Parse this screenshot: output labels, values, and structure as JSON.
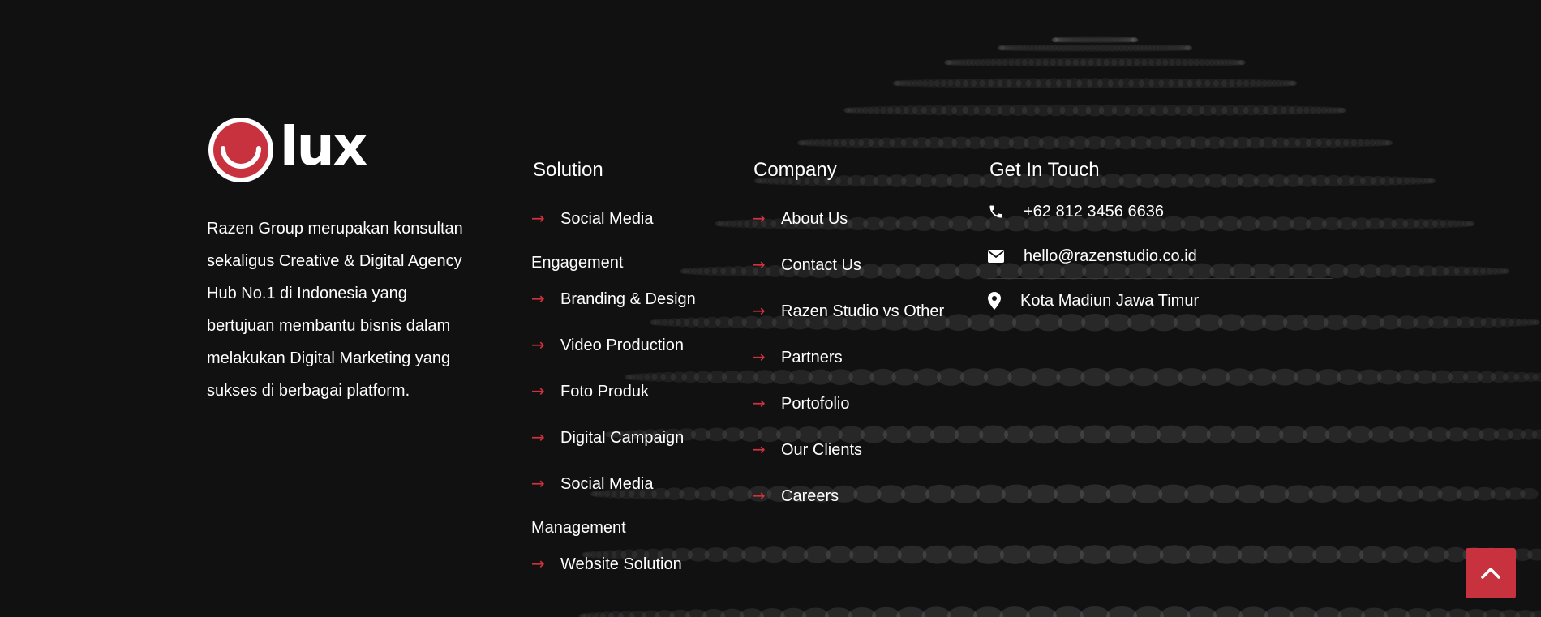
{
  "brand": {
    "logo_text": "lux",
    "description": "Razen Group merupakan konsultan sekaligus Creative & Digital Agency Hub No.1 di Indonesia yang bertujuan membantu bisnis dalam melakukan Digital Marketing yang sukses di berbagai platform."
  },
  "solution": {
    "title": "Solution",
    "items": [
      {
        "label": "Social Media",
        "cont": "Engagement"
      },
      {
        "label": "Branding & Design"
      },
      {
        "label": "Video Production"
      },
      {
        "label": "Foto Produk"
      },
      {
        "label": "Digital Campaign"
      },
      {
        "label": "Social Media",
        "cont": "Management"
      },
      {
        "label": "Website Solution"
      }
    ]
  },
  "company": {
    "title": "Company",
    "items": [
      {
        "label": "About Us"
      },
      {
        "label": "Contact Us"
      },
      {
        "label": "Razen Studio vs Other"
      },
      {
        "label": "Partners"
      },
      {
        "label": "Portofolio"
      },
      {
        "label": "Our Clients"
      },
      {
        "label": "Careers"
      }
    ]
  },
  "contact": {
    "title": "Get In Touch",
    "phone": "+62 812 3456 6636",
    "email": "hello@razenstudio.co.id",
    "address": "Kota Madiun Jawa Timur"
  },
  "icons": {
    "arrow": "arrow-right-icon",
    "phone": "phone-icon",
    "email": "envelope-icon",
    "address": "map-pin-icon",
    "scroll_top": "chevron-up-icon"
  },
  "colors": {
    "background": "#111112",
    "accent": "#c8313e",
    "text": "#ffffff"
  }
}
